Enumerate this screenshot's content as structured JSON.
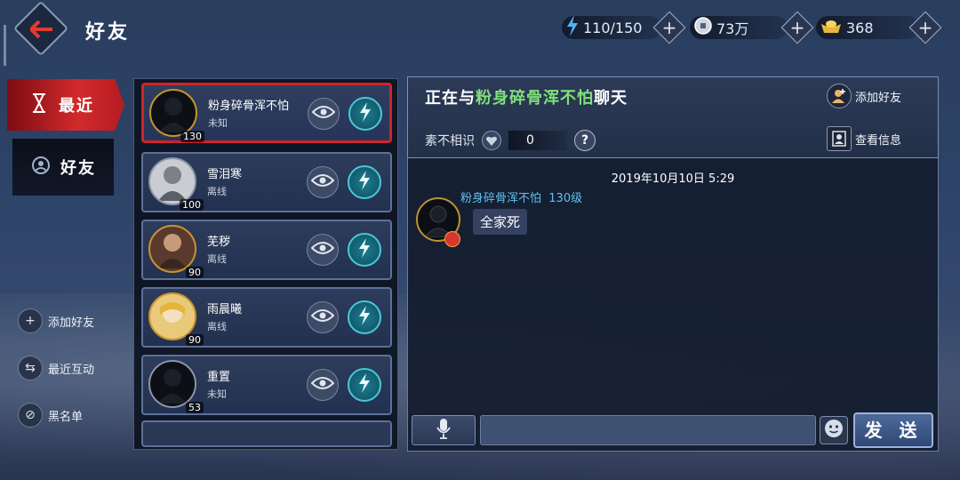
{
  "header": {
    "title": "好友",
    "resources": [
      {
        "name": "stamina",
        "icon": "lightning-icon",
        "value": "110/150"
      },
      {
        "name": "silver",
        "icon": "coin-icon",
        "value": "73万"
      },
      {
        "name": "gold",
        "icon": "gold-ingot-icon",
        "value": "368"
      }
    ]
  },
  "sidebar": {
    "tabs": [
      {
        "label": "最近",
        "icon": "hourglass-icon",
        "active": true
      },
      {
        "label": "好友",
        "icon": "friend-group-icon",
        "active": false
      }
    ],
    "actions": [
      {
        "label": "添加好友",
        "icon": "add-friend-icon"
      },
      {
        "label": "最近互动",
        "icon": "swap-arrows-icon"
      },
      {
        "label": "黑名单",
        "icon": "blacklist-icon"
      }
    ]
  },
  "friends": [
    {
      "name": "粉身碎骨浑不怕",
      "status": "未知",
      "level": "130",
      "active": true
    },
    {
      "name": "雪泪寒",
      "status": "离线",
      "level": "100",
      "active": false
    },
    {
      "name": "芜秽",
      "status": "离线",
      "level": "90",
      "active": false
    },
    {
      "name": "雨晨曦",
      "status": "离线",
      "level": "90",
      "active": false
    },
    {
      "name": "重置",
      "status": "未知",
      "level": "53",
      "active": false
    }
  ],
  "chat": {
    "title_prefix": "正在与",
    "partner_name": "粉身碎骨浑不怕",
    "title_suffix": "聊天",
    "add_friend_label": "添加好友",
    "view_info_label": "查看信息",
    "intimacy_label": "素不相识",
    "intimacy_value": "0",
    "help_label": "?",
    "timestamp": "2019年10月10日 5:29",
    "messages": [
      {
        "sender": "粉身碎骨浑不怕",
        "level_text": "130级",
        "text": "全家死"
      }
    ],
    "input_value": "",
    "send_label": "发 送"
  },
  "colors": {
    "accent_red": "#d22a2c",
    "highlight_green": "#7fe07a",
    "sender_blue": "#5fc0ef",
    "cyan_button": "#49c8d8"
  }
}
